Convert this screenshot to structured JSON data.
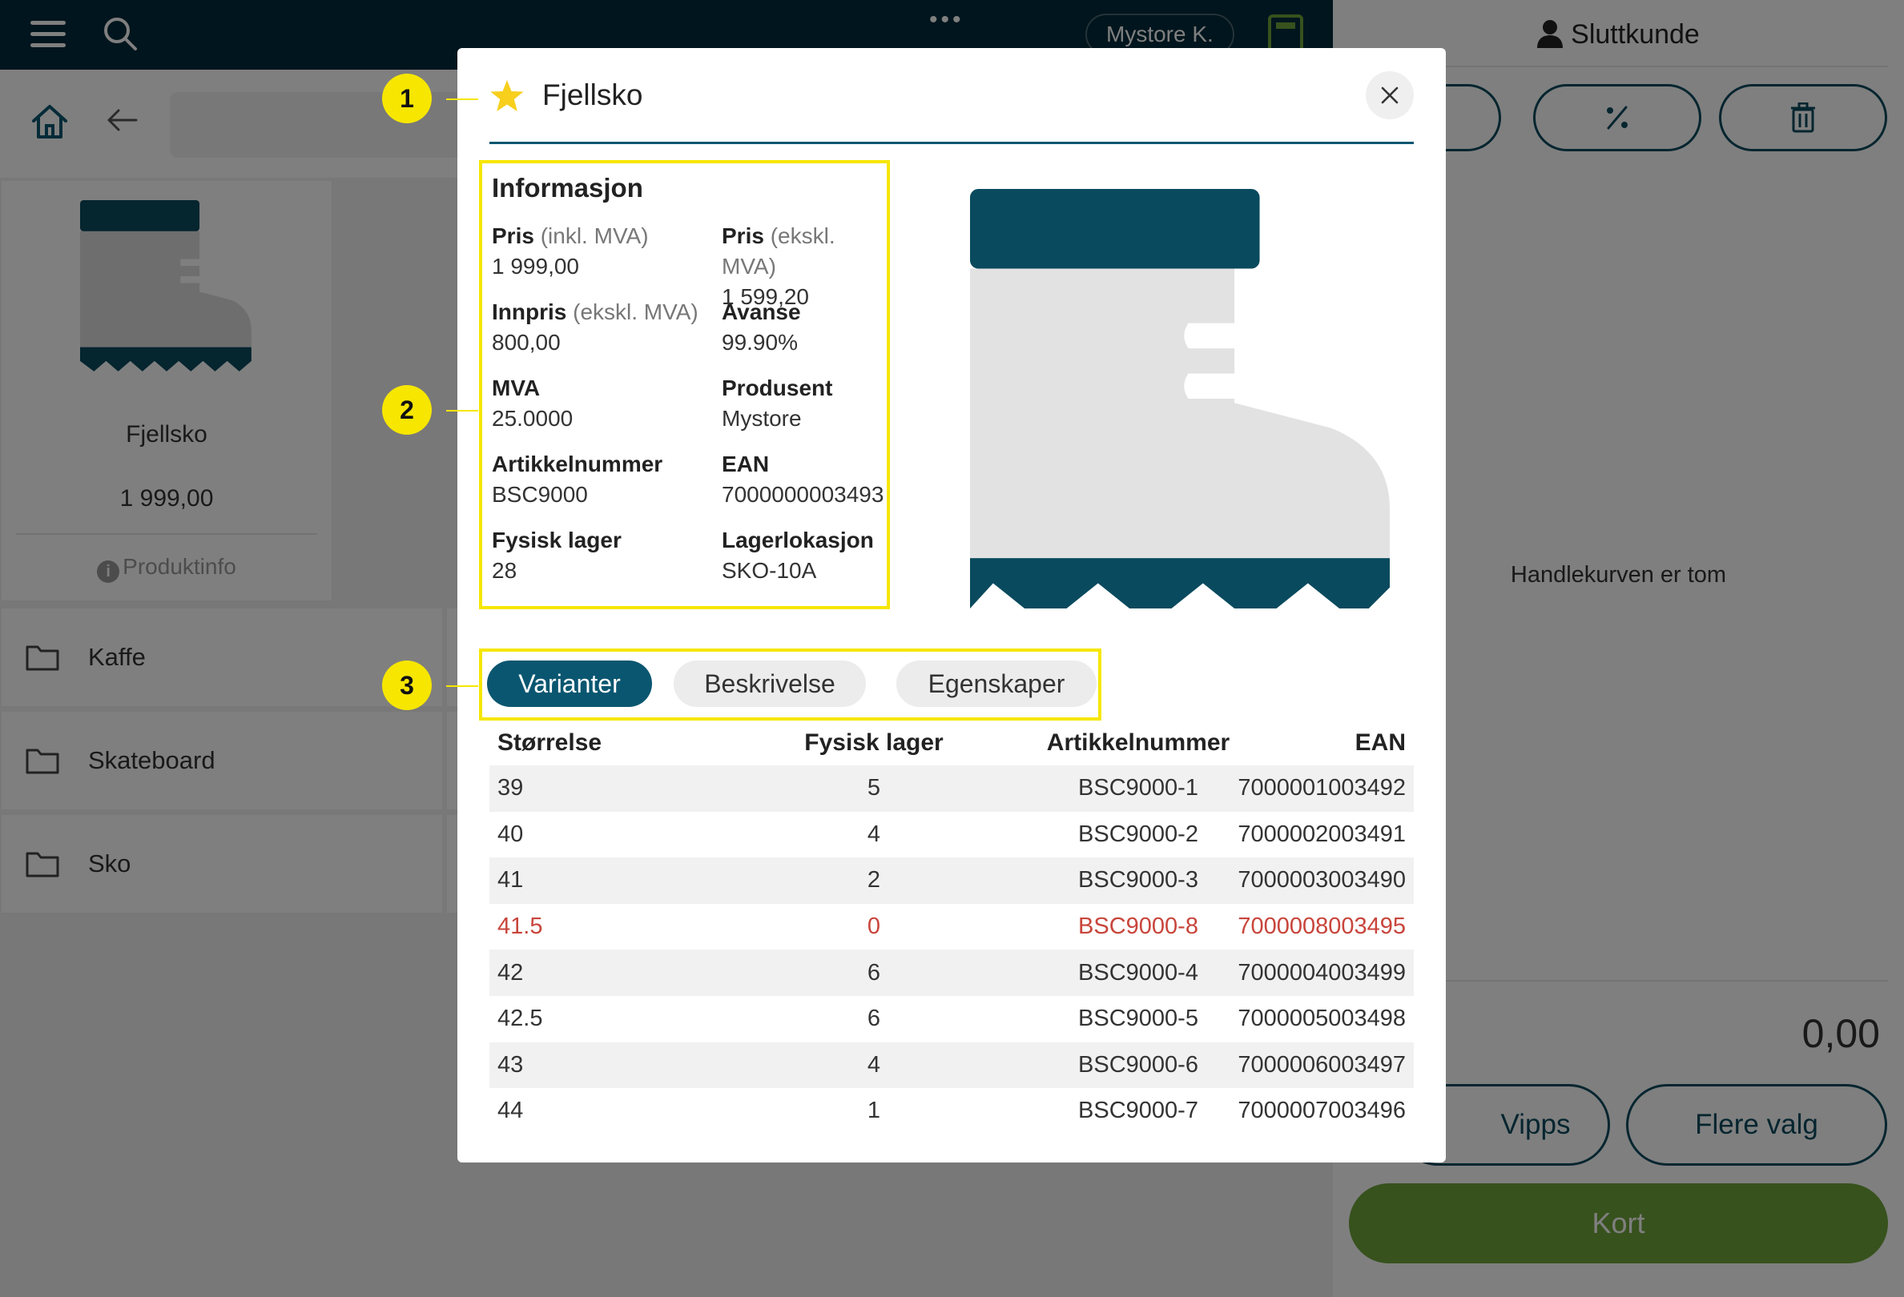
{
  "topbar": {
    "store_label": "Mystore K.",
    "dots": "•••"
  },
  "grid": {
    "product": {
      "name": "Fjellsko",
      "price": "1 999,00",
      "info_label": "Produktinfo"
    },
    "folders": [
      "Kaffe",
      "Skateboard",
      "Sko"
    ]
  },
  "cart": {
    "customer_label": "Sluttkunde",
    "empty_text": "Handlekurven er tom",
    "total": "0,00",
    "vipps_label": "Vipps",
    "more_label": "Flere valg",
    "card_label": "Kort"
  },
  "modal": {
    "title": "Fjellsko",
    "info": {
      "heading": "Informasjon",
      "price_incl_label": "Pris",
      "price_incl_sub": "(inkl. MVA)",
      "price_incl_value": "1 999,00",
      "price_excl_label": "Pris",
      "price_excl_sub": "(ekskl. MVA)",
      "price_excl_value": "1 599,20",
      "cost_label": "Innpris",
      "cost_sub": "(ekskl. MVA)",
      "cost_value": "800,00",
      "margin_label": "Avanse",
      "margin_value": "99.90%",
      "vat_label": "MVA",
      "vat_value": "25.0000",
      "producer_label": "Produsent",
      "producer_value": "Mystore",
      "sku_label": "Artikkelnummer",
      "sku_value": "BSC9000",
      "ean_label": "EAN",
      "ean_value": "7000000003493",
      "stock_label": "Fysisk lager",
      "stock_value": "28",
      "location_label": "Lagerlokasjon",
      "location_value": "SKO-10A"
    },
    "tabs": [
      "Varianter",
      "Beskrivelse",
      "Egenskaper"
    ],
    "table": {
      "headers": [
        "Størrelse",
        "Fysisk lager",
        "Artikkelnummer",
        "EAN"
      ],
      "rows": [
        [
          "39",
          "5",
          "BSC9000-1",
          "7000001003492"
        ],
        [
          "40",
          "4",
          "BSC9000-2",
          "7000002003491"
        ],
        [
          "41",
          "2",
          "BSC9000-3",
          "7000003003490"
        ],
        [
          "41.5",
          "0",
          "BSC9000-8",
          "7000008003495"
        ],
        [
          "42",
          "6",
          "BSC9000-4",
          "7000004003499"
        ],
        [
          "42.5",
          "6",
          "BSC9000-5",
          "7000005003498"
        ],
        [
          "43",
          "4",
          "BSC9000-6",
          "7000006003497"
        ],
        [
          "44",
          "1",
          "BSC9000-7",
          "7000007003496"
        ]
      ]
    }
  },
  "callouts": [
    "1",
    "2",
    "3"
  ],
  "colors": {
    "brand_dark": "#012a3a",
    "accent": "#0a5670",
    "highlight": "#f6e600",
    "out_of_stock": "#c8453b",
    "card_button": "#6fa43a"
  }
}
